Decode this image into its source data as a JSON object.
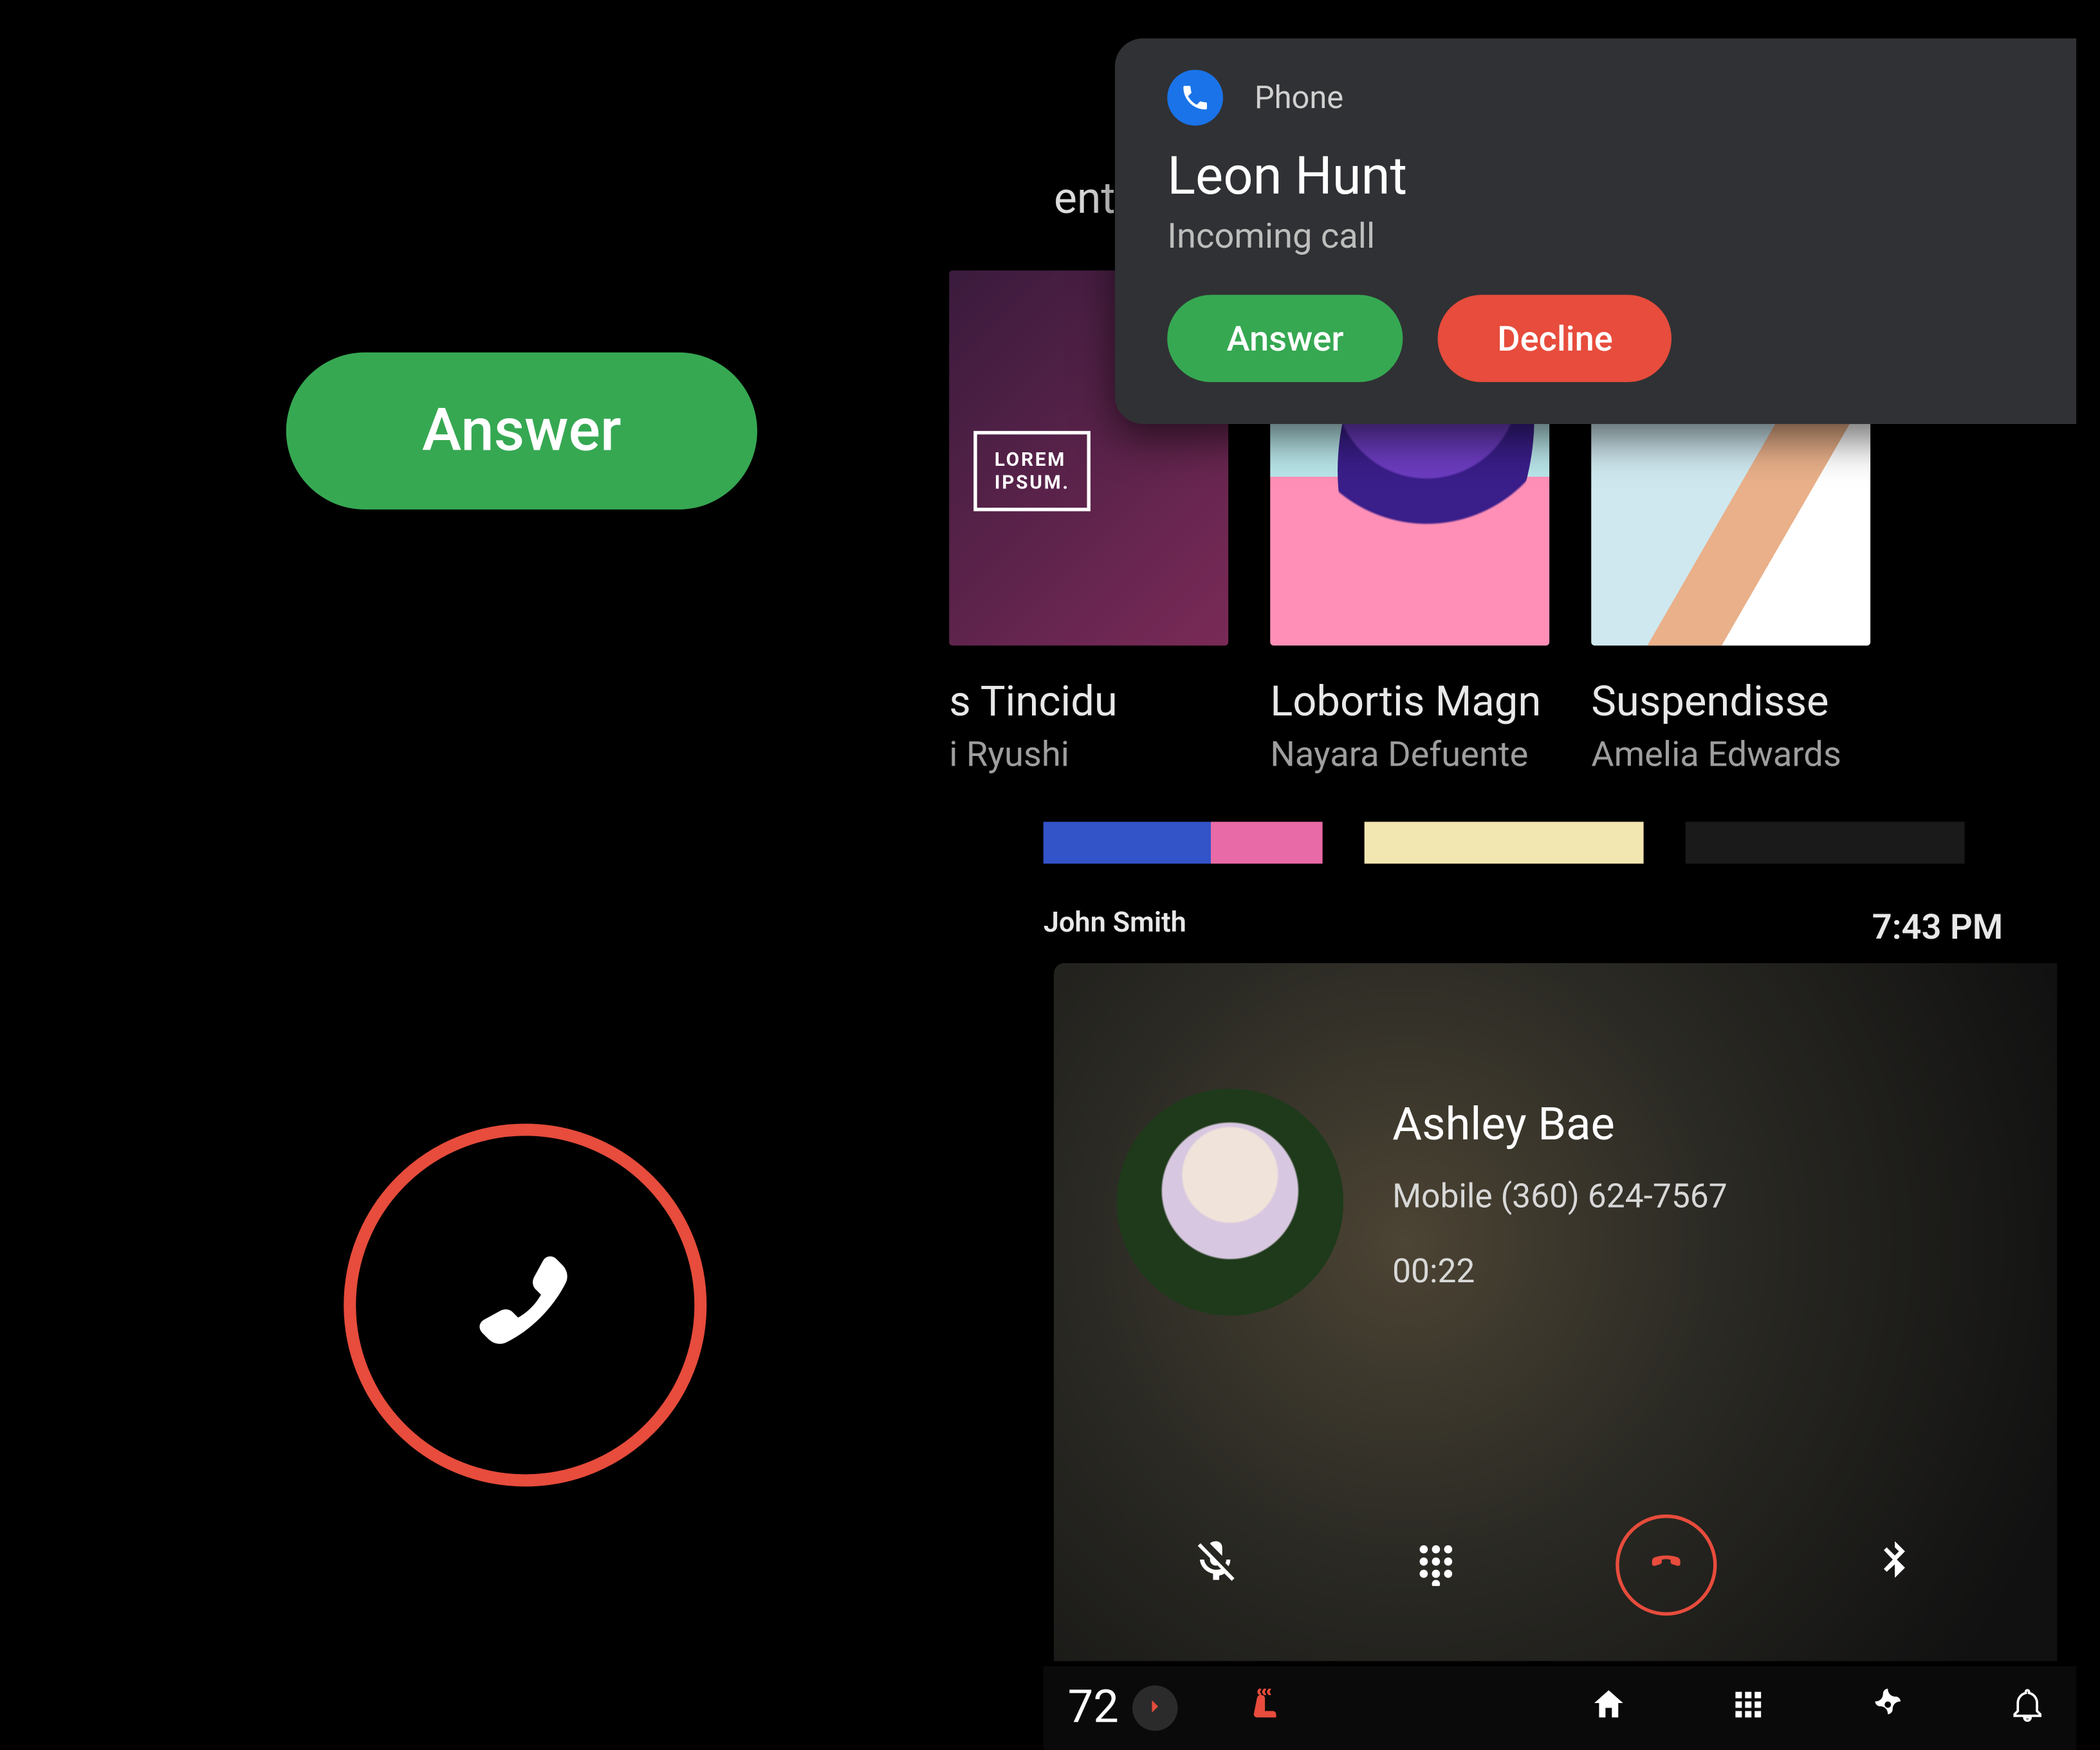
{
  "left_panel": {
    "answer_label": "Answer"
  },
  "incoming_card": {
    "app_name": "Phone",
    "caller_name": "Leon Hunt",
    "subtitle": "Incoming call",
    "answer_label": "Answer",
    "decline_label": "Decline"
  },
  "background_fragment": "ent",
  "media": {
    "items": [
      {
        "title": "s Tincidu",
        "subtitle": "i Ryushi"
      },
      {
        "title": "Lobortis Magn",
        "subtitle": "Nayara Defuente"
      },
      {
        "title": "Suspendisse",
        "subtitle": "Amelia Edwards"
      }
    ]
  },
  "status": {
    "user": "John Smith",
    "time": "7:43 PM"
  },
  "ongoing_call": {
    "name": "Ashley Bae",
    "line": "Mobile (360) 624-7567",
    "duration": "00:22"
  },
  "ongoing_controls": {
    "mute": "mute",
    "dialpad": "dialpad",
    "end": "end-call",
    "bluetooth": "bluetooth"
  },
  "navbar": {
    "temperature": "72",
    "icons": {
      "seat_heat": "seat-heater",
      "home": "home",
      "apps": "apps-grid",
      "fan": "fan",
      "notifications": "notifications-bell"
    }
  },
  "colors": {
    "green": "#36A852",
    "red": "#E74C3C",
    "blue": "#1A73E8",
    "card_bg": "#303134"
  }
}
